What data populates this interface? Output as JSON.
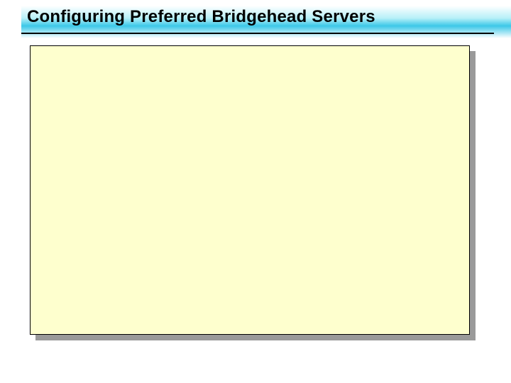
{
  "slide": {
    "title": "Configuring Preferred Bridgehead Servers"
  },
  "colors": {
    "title_gradient_mid": "#3cc8e8",
    "body_fill": "#feffce",
    "body_shadow": "#9a9a9a"
  }
}
